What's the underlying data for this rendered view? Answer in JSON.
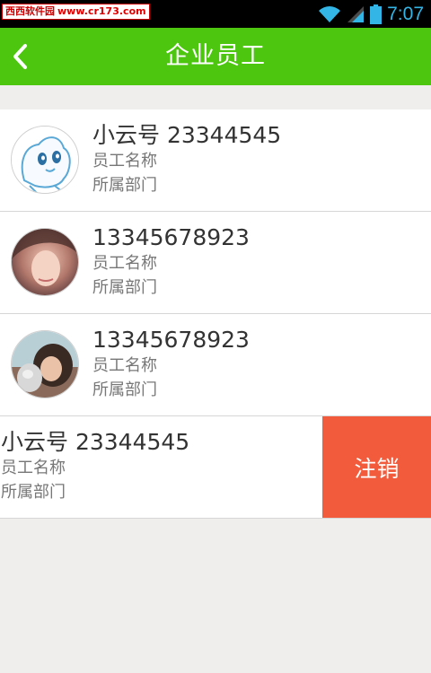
{
  "status_bar": {
    "watermark_site": "西西软件园",
    "watermark_url": "www.cr173.com",
    "time": "7:07",
    "icons": [
      "wifi-icon",
      "signal-icon",
      "battery-icon"
    ]
  },
  "app_bar": {
    "title": "企业员工",
    "back_icon": "back-arrow-icon"
  },
  "employees": [
    {
      "name": "小云号 23344545",
      "label": "员工名称",
      "dept": "所属部门",
      "avatar": "cartoon-rabbit"
    },
    {
      "name": "13345678923",
      "label": "员工名称",
      "dept": "所属部门",
      "avatar": "photo-woman"
    },
    {
      "name": "13345678923",
      "label": "员工名称",
      "dept": "所属部门",
      "avatar": "photo-girl-cat"
    },
    {
      "name": "小云号 23344545",
      "label": "员工名称",
      "dept": "所属部门",
      "avatar": ""
    }
  ],
  "swipe_action": {
    "label": "注销",
    "color": "#f25c3c"
  },
  "colors": {
    "app_bar": "#4cc60f",
    "background": "#efeeec",
    "status_time": "#33b5e5"
  }
}
